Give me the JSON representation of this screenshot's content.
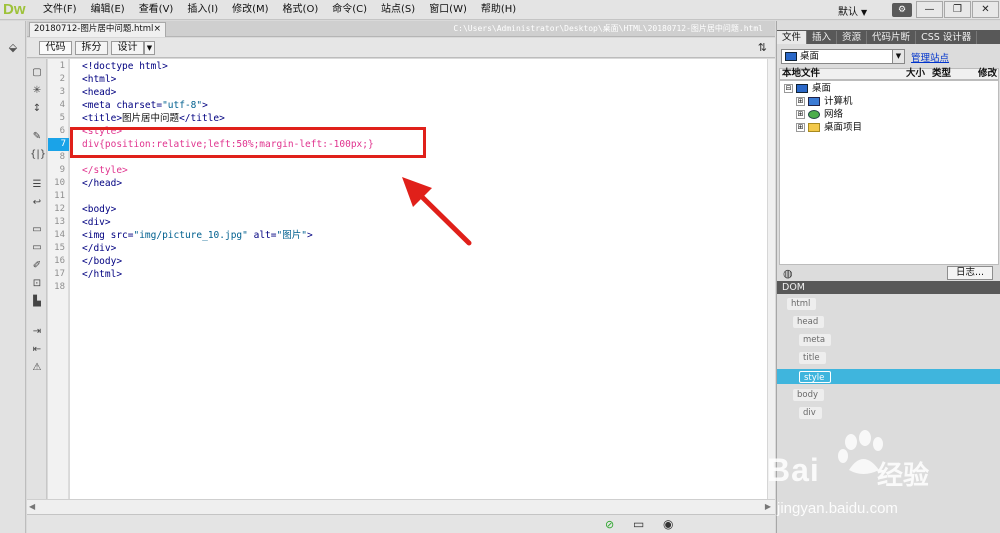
{
  "app": {
    "logo": "Dw"
  },
  "menu": [
    "文件(F)",
    "编辑(E)",
    "查看(V)",
    "插入(I)",
    "修改(M)",
    "格式(O)",
    "命令(C)",
    "站点(S)",
    "窗口(W)",
    "帮助(H)"
  ],
  "workspace": "默认",
  "document": {
    "tab_label": "20180712-图片居中问题.html",
    "path": "C:\\Users\\Administrator\\Desktop\\桌面\\HTML\\20180712-图片居中问题.html",
    "view_buttons": {
      "code": "代码",
      "split": "拆分",
      "design": "设计"
    }
  },
  "code": {
    "active_line": 7,
    "lines": [
      {
        "n": "1",
        "text": "<!doctype html>"
      },
      {
        "n": "2",
        "text": "<html>"
      },
      {
        "n": "3",
        "text": "<head>"
      },
      {
        "n": "4",
        "pre": "<meta charset=",
        "str": "\"utf-8\"",
        "post": ">"
      },
      {
        "n": "5",
        "pre": "<title>",
        "plain": "图片居中问题",
        "post": "</title>"
      },
      {
        "n": "6",
        "text": "<style>"
      },
      {
        "n": "7",
        "text": "div{position:relative;left:50%;margin-left:-100px;}"
      },
      {
        "n": "8",
        "text": ""
      },
      {
        "n": "9",
        "text": "</style>"
      },
      {
        "n": "10",
        "text": "</head>"
      },
      {
        "n": "11",
        "text": ""
      },
      {
        "n": "12",
        "text": "<body>"
      },
      {
        "n": "13",
        "text": "<div>"
      },
      {
        "n": "14",
        "pre": "<img src=",
        "str": "\"img/picture_10.jpg\"",
        "mid": " alt=",
        "str2": "\"图片\"",
        "post": ">"
      },
      {
        "n": "15",
        "text": "</div>"
      },
      {
        "n": "16",
        "text": "</body>"
      },
      {
        "n": "17",
        "text": "</html>"
      },
      {
        "n": "18",
        "text": ""
      }
    ]
  },
  "files_panel": {
    "tabs": [
      "文件",
      "插入",
      "资源",
      "代码片断",
      "CSS 设计器"
    ],
    "active_tab": "文件",
    "site": "桌面",
    "manage_link": "管理站点",
    "columns": [
      "本地文件",
      "大小",
      "类型",
      "修改"
    ],
    "tree": [
      {
        "label": "桌面",
        "icon": "monitor-icon",
        "expander": "⊟"
      },
      {
        "label": "计算机",
        "icon": "computer-icon",
        "expander": "⊞"
      },
      {
        "label": "网络",
        "icon": "network-icon",
        "expander": "⊞"
      },
      {
        "label": "桌面项目",
        "icon": "folder-icon",
        "expander": "⊞"
      }
    ],
    "log_button": "日志..."
  },
  "dom_panel": {
    "title": "DOM",
    "nodes": [
      "html",
      "head",
      "meta",
      "title",
      "style",
      "body",
      "div"
    ],
    "selected": "style"
  },
  "watermark": {
    "brand": "Bai",
    "brand2": "经验",
    "url": "jingyan.baidu.com"
  },
  "colors": {
    "active_line": "#1aa3e8",
    "highlight_box": "#e0201a",
    "dom_selected": "#3fb5dd",
    "tag": "#000080",
    "style_block": "#e0338e"
  }
}
